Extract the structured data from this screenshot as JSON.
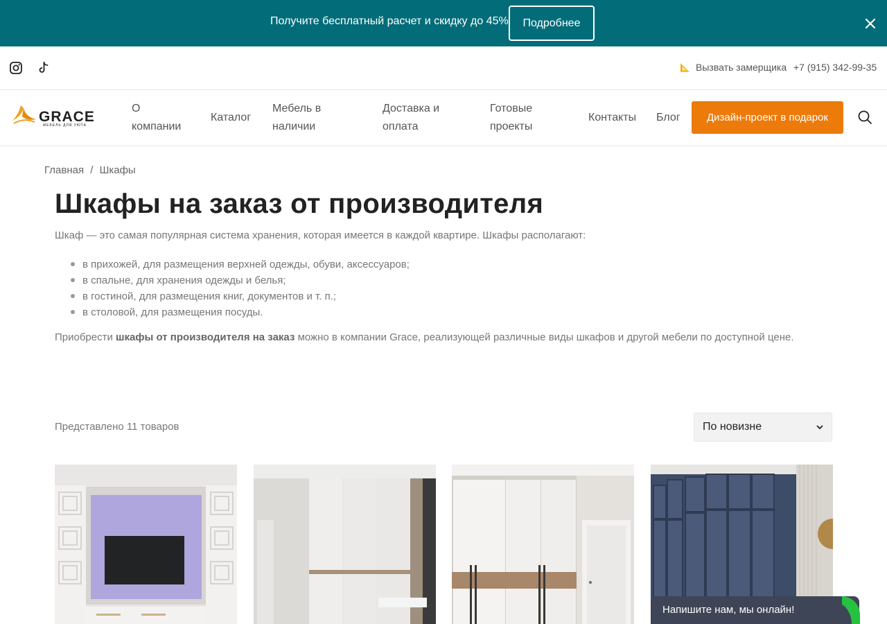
{
  "promo": {
    "text": "Получите бесплатный расчет и скидку до 45%",
    "button_label": "Подробнее"
  },
  "topbar": {
    "measure_label": "Вызвать замерщика",
    "phone": "+7 (915) 342-99-35"
  },
  "logo": {
    "name": "GRACE",
    "tagline": "МЕБЕЛЬ ДЛЯ УЮТА"
  },
  "nav": {
    "items": [
      {
        "label_line1": "О",
        "label_line2": "компании"
      },
      {
        "label_line1": "Каталог",
        "label_line2": ""
      },
      {
        "label_line1": "Мебель в",
        "label_line2": "наличии"
      },
      {
        "label_line1": "Доставка и",
        "label_line2": "оплата"
      },
      {
        "label_line1": "Готовые",
        "label_line2": "проекты"
      },
      {
        "label_line1": "Контакты",
        "label_line2": ""
      },
      {
        "label_line1": "Блог",
        "label_line2": ""
      }
    ],
    "cta_label": "Дизайн-проект в подарок"
  },
  "breadcrumb": {
    "home": "Главная",
    "separator": "/",
    "current": "Шкафы"
  },
  "main": {
    "title": "Шкафы на заказ от производителя",
    "intro": "Шкаф — это самая популярная система хранения, которая имеется в каждой квартире. Шкафы располагают:",
    "bullets": [
      "в прихожей, для размещения верхней одежды, обуви, аксессуаров;",
      "в спальне, для хранения одежды и белья;",
      "в гостиной, для размещения книг, документов и т. п.;",
      "в столовой, для размещения посуды."
    ],
    "para_prefix": "Приобрести ",
    "para_bold": "шкафы от производителя на заказ",
    "para_suffix": " можно в компании Grace, реализующей различные виды шкафов и другой мебели по доступной цене."
  },
  "catalog": {
    "count_text": "Представлено 11 товаров",
    "sort_selected": "По новизне"
  },
  "chat": {
    "label": "Напишите нам, мы онлайн!"
  },
  "colors": {
    "promo_bg": "#026d79",
    "cta_bg": "#ec7b0b",
    "chat_bg": "#3e4556",
    "online_green": "#25c13f"
  }
}
